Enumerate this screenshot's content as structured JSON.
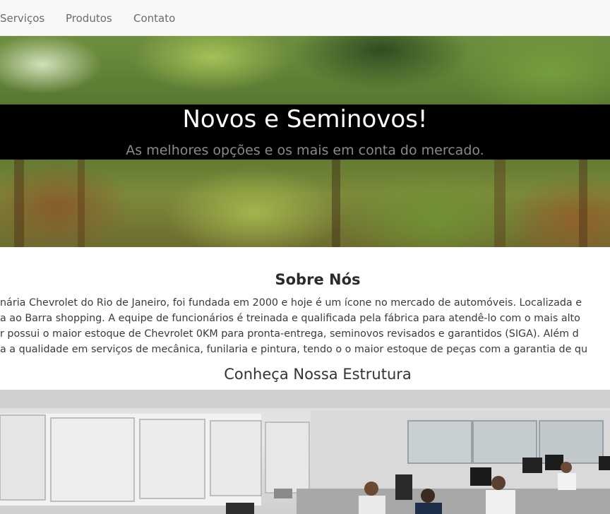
{
  "nav": {
    "items": [
      {
        "label": "Serviços"
      },
      {
        "label": "Produtos"
      },
      {
        "label": "Contato"
      }
    ]
  },
  "hero": {
    "title": "Novos e Seminovos!",
    "subtitle": "As melhores opções e os mais em conta do mercado."
  },
  "about": {
    "title": "Sobre Nós",
    "lines": [
      "nária Chevrolet do Rio de Janeiro, foi fundada em 2000 e hoje é um ícone no mercado de automóveis. Localizada e",
      "a ao Barra shopping. A equipe de funcionários é treinada e qualificada pela fábrica para atendê-lo com o mais alto",
      "r possui o maior estoque de Chevrolet 0KM para pronta-entrega, seminovos revisados e garantidos (SIGA). Além d",
      "a a qualidade em serviços de mecânica, funilaria e pintura, tendo o o maior estoque de peças com a garantia de qu"
    ]
  },
  "structure": {
    "title": "Conheça Nossa Estrutura"
  },
  "colors": {
    "navbar_bg": "#f8f8f8",
    "nav_text": "#6b6b6b",
    "hero_band": "#000000",
    "hero_title": "#ffffff",
    "hero_subtitle": "#8a8a8a"
  }
}
